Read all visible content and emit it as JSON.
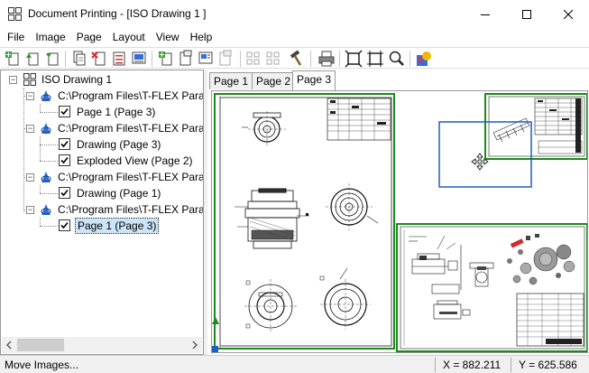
{
  "window": {
    "title": "Document Printing - [ISO Drawing 1 ]"
  },
  "menu": [
    "File",
    "Image",
    "Page",
    "Layout",
    "View",
    "Help"
  ],
  "tree": {
    "root": "ISO Drawing 1",
    "docs": [
      {
        "path": "C:\\Program Files\\T-FLEX Parametric",
        "pages": [
          "Page 1 (Page 3)"
        ]
      },
      {
        "path": "C:\\Program Files\\T-FLEX Parametric",
        "pages": [
          "Drawing (Page 3)",
          "Exploded View (Page 2)"
        ]
      },
      {
        "path": "C:\\Program Files\\T-FLEX Parametric",
        "pages": [
          "Drawing (Page 1)"
        ]
      },
      {
        "path": "C:\\Program Files\\T-FLEX Parametric",
        "pages": [
          "Page 1 (Page 3)"
        ]
      }
    ]
  },
  "tabs": [
    "Page 1",
    "Page 2",
    "Page 3"
  ],
  "active_tab": 2,
  "status": {
    "message": "Move Images...",
    "x": "X = 882.211",
    "y": "Y = 625.586"
  },
  "colors": {
    "selection": "#cce4f7",
    "frame_green": "#1a8a1a",
    "viewport_blue": "#1f5fbf",
    "doc_icon_blue": "#2f6fd6",
    "accent_red": "#d22a2a"
  }
}
